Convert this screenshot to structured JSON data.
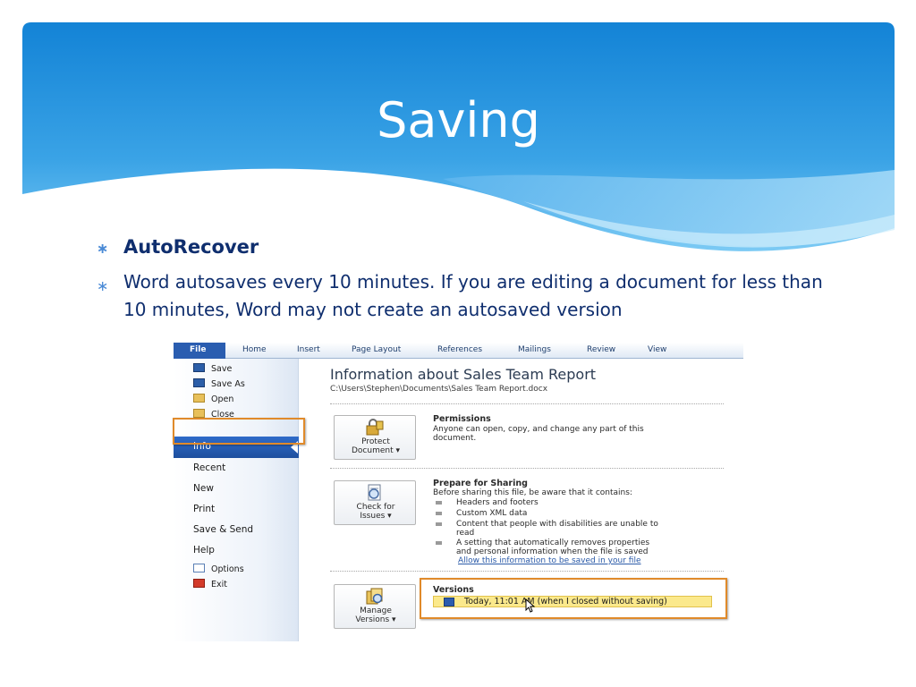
{
  "slide": {
    "title": "Saving",
    "colors": {
      "band_dark": "#1a86d6",
      "band_light": "#7cc6f3",
      "text": "#0f2e6e",
      "highlight": "#e08a2a"
    }
  },
  "bullets": [
    {
      "icon": "asterisk-bullet-icon",
      "text": "AutoRecover"
    },
    {
      "icon": "asterisk-bullet-icon",
      "text": "Word autosaves every 10 minutes. If you are editing a document for less than 10 minutes, Word may not create an autosaved version"
    }
  ],
  "word": {
    "ribbon_tabs": [
      "File",
      "Home",
      "Insert",
      "Page Layout",
      "References",
      "Mailings",
      "Review",
      "View"
    ],
    "menu_small": [
      {
        "label": "Save",
        "icon": "save-icon"
      },
      {
        "label": "Save As",
        "icon": "save-as-icon"
      },
      {
        "label": "Open",
        "icon": "open-folder-icon"
      },
      {
        "label": "Close",
        "icon": "close-folder-icon"
      }
    ],
    "menu_selected": "Info",
    "menu_large": [
      "Recent",
      "New",
      "Print",
      "Save & Send",
      "Help"
    ],
    "menu_bottom": [
      {
        "label": "Options",
        "icon": "options-icon"
      },
      {
        "label": "Exit",
        "icon": "exit-icon"
      }
    ],
    "info_title": "Information about Sales Team Report",
    "info_path": "C:\\Users\\Stephen\\Documents\\Sales Team Report.docx",
    "permissions": {
      "button": [
        "Protect",
        "Document ▾"
      ],
      "heading": "Permissions",
      "text": [
        "Anyone can open, copy, and change any part of this",
        "document."
      ]
    },
    "sharing": {
      "button": [
        "Check for",
        "Issues ▾"
      ],
      "heading": "Prepare for Sharing",
      "intro": "Before sharing this file, be aware that it contains:",
      "items": [
        [
          "Headers and footers"
        ],
        [
          "Custom XML data"
        ],
        [
          "Content that people with disabilities are unable to",
          "read"
        ],
        [
          "A setting that automatically removes properties",
          "and personal information when the file is saved"
        ]
      ],
      "link": "Allow this information to be saved in your file"
    },
    "versions": {
      "button": [
        "Manage",
        "Versions ▾"
      ],
      "heading": "Versions",
      "entry": "Today, 11:01 AM (when I closed without saving)"
    }
  }
}
